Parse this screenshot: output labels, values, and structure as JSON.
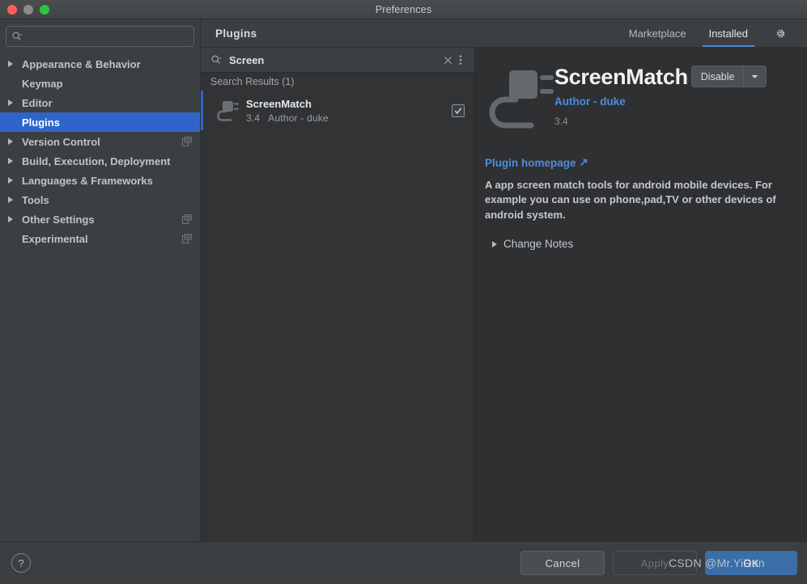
{
  "window": {
    "title": "Preferences",
    "controls": [
      "close",
      "minimize",
      "zoom"
    ]
  },
  "sidebar": {
    "search_placeholder": "",
    "items": [
      {
        "label": "Appearance & Behavior",
        "expandable": true,
        "selected": false,
        "project_icon": false
      },
      {
        "label": "Keymap",
        "expandable": false,
        "selected": false,
        "project_icon": false
      },
      {
        "label": "Editor",
        "expandable": true,
        "selected": false,
        "project_icon": false
      },
      {
        "label": "Plugins",
        "expandable": false,
        "selected": true,
        "project_icon": false
      },
      {
        "label": "Version Control",
        "expandable": true,
        "selected": false,
        "project_icon": true
      },
      {
        "label": "Build, Execution, Deployment",
        "expandable": true,
        "selected": false,
        "project_icon": false
      },
      {
        "label": "Languages & Frameworks",
        "expandable": true,
        "selected": false,
        "project_icon": false
      },
      {
        "label": "Tools",
        "expandable": true,
        "selected": false,
        "project_icon": false
      },
      {
        "label": "Other Settings",
        "expandable": true,
        "selected": false,
        "project_icon": true
      },
      {
        "label": "Experimental",
        "expandable": false,
        "selected": false,
        "project_icon": true
      }
    ]
  },
  "plugins_panel": {
    "title": "Plugins",
    "tabs": [
      {
        "label": "Marketplace",
        "active": false
      },
      {
        "label": "Installed",
        "active": true
      }
    ],
    "settings_icon": "gear-icon",
    "search": {
      "value": "Screen",
      "clear_icon": "close-icon",
      "options_icon": "kebab-menu-icon"
    },
    "results_header": "Search Results (1)",
    "results": [
      {
        "name": "ScreenMatch",
        "version": "3.4",
        "author": "Author - duke",
        "enabled": true,
        "selected": true
      }
    ]
  },
  "detail": {
    "title": "ScreenMatch",
    "action_button": "Disable",
    "action_dropdown_icon": "chevron-down-icon",
    "author": "Author - duke",
    "version": "3.4",
    "homepage_link": "Plugin homepage",
    "external_link_icon": "↗",
    "description": "A app screen match tools for android mobile devices. For example you can use on phone,pad,TV or other devices of android system.",
    "change_notes_label": "Change Notes"
  },
  "footer": {
    "help_label": "?",
    "cancel_label": "Cancel",
    "apply_label": "Apply",
    "ok_label": "OK"
  },
  "watermark": "CSDN @Mr.YiRan",
  "colors": {
    "accent_blue": "#2f65ca",
    "link_blue": "#4c8ddc",
    "tab_underline": "#4a88d8",
    "primary_button": "#3b6ea8",
    "window_bg": "#3c3f41",
    "list_bg": "#313335",
    "detail_bg": "#2e3032"
  }
}
